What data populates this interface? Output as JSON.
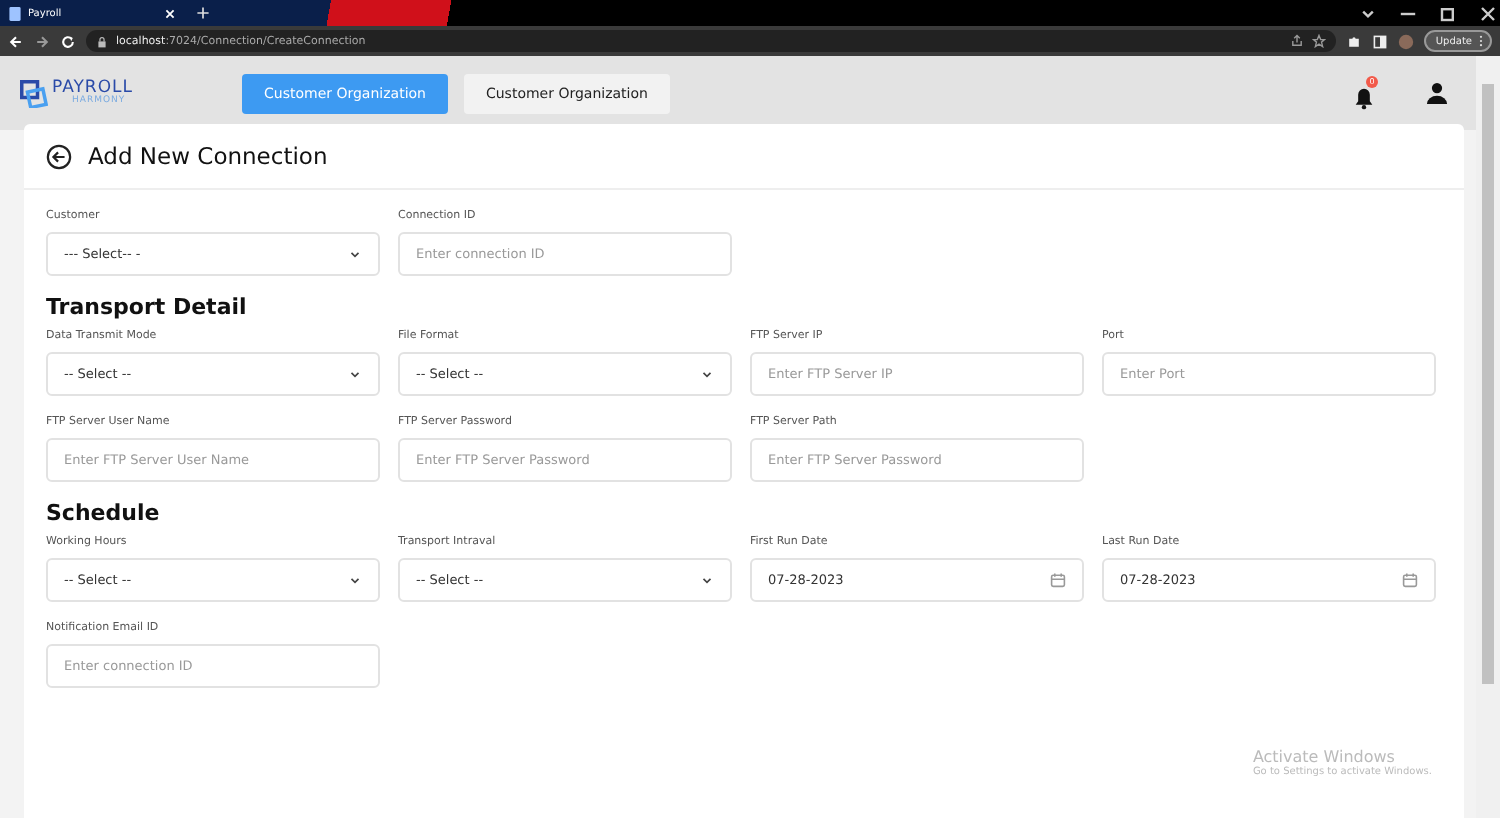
{
  "browser": {
    "tab_title": "Payroll",
    "url_host": "localhost",
    "url_rest": ":7024/Connection/CreateConnection",
    "update_button": "Update"
  },
  "header": {
    "logo": {
      "line1": "PAYROLL",
      "line2": "HARMONY"
    },
    "nav_buttons": [
      {
        "label": "Customer Organization",
        "selected": true
      },
      {
        "label": "Customer Organization",
        "selected": false
      }
    ],
    "notification_count": "0"
  },
  "page_title": "Add New Connection",
  "sections": [
    {
      "rows": [
        [
          {
            "label": "Customer",
            "kind": "select",
            "value": "--- Select-- -"
          },
          {
            "label": "Connection ID",
            "kind": "text",
            "placeholder": "Enter connection ID"
          }
        ]
      ]
    },
    {
      "heading": "Transport Detail",
      "rows": [
        [
          {
            "label": "Data Transmit Mode",
            "kind": "select",
            "value": "-- Select --"
          },
          {
            "label": "File Format",
            "kind": "select",
            "value": "-- Select --"
          },
          {
            "label": "FTP Server IP",
            "kind": "text",
            "placeholder": "Enter FTP Server IP"
          },
          {
            "label": "Port",
            "kind": "text",
            "placeholder": "Enter Port"
          }
        ],
        [
          {
            "label": "FTP Server User Name",
            "kind": "text",
            "placeholder": "Enter FTP Server User Name"
          },
          {
            "label": "FTP Server Password",
            "kind": "text",
            "placeholder": "Enter FTP Server Password"
          },
          {
            "label": "FTP Server Path",
            "kind": "text",
            "placeholder": "Enter FTP Server Password"
          }
        ]
      ]
    },
    {
      "heading": "Schedule",
      "rows": [
        [
          {
            "label": "Working Hours",
            "kind": "select",
            "value": "-- Select --"
          },
          {
            "label": "Transport Intraval",
            "kind": "select",
            "value": "-- Select --"
          },
          {
            "label": "First Run Date",
            "kind": "date",
            "value": "07-28-2023"
          },
          {
            "label": "Last Run Date",
            "kind": "date",
            "value": "07-28-2023"
          }
        ],
        [
          {
            "label": "Notification Email ID",
            "kind": "text",
            "placeholder": "Enter connection ID"
          }
        ]
      ]
    }
  ],
  "os_notice": {
    "title": "Activate Windows",
    "subtitle": "Go to Settings to activate Windows."
  }
}
